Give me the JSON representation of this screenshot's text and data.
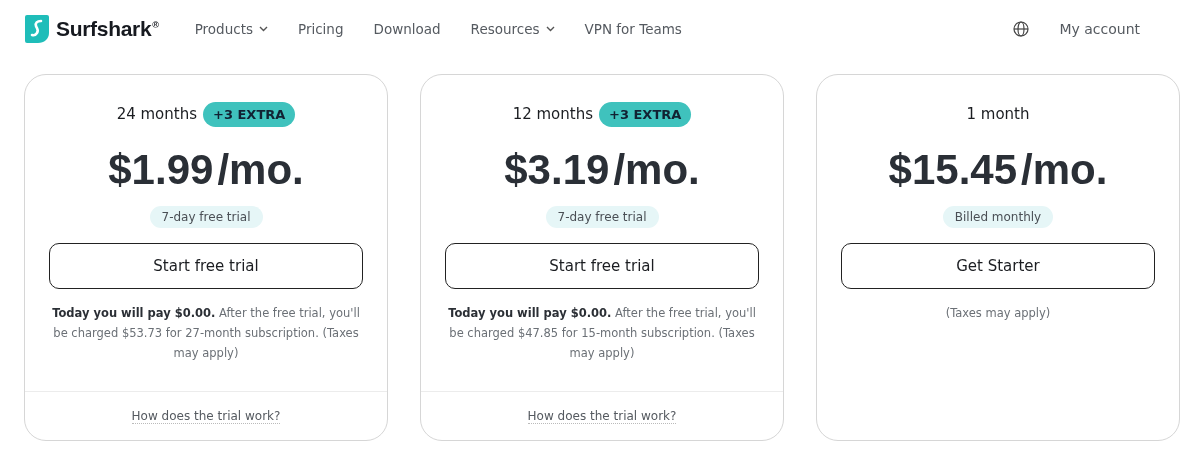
{
  "header": {
    "logo": "Surfshark",
    "logo_mark": "®",
    "nav": [
      {
        "label": "Products",
        "dropdown": true
      },
      {
        "label": "Pricing",
        "dropdown": false
      },
      {
        "label": "Download",
        "dropdown": false
      },
      {
        "label": "Resources",
        "dropdown": true
      },
      {
        "label": "VPN for Teams",
        "dropdown": false
      }
    ],
    "account": "My account"
  },
  "plans": [
    {
      "term": "24 months",
      "badge": "+3 EXTRA",
      "price": "$1.99",
      "unit": "/mo.",
      "pill": "7-day free trial",
      "button": "Start free trial",
      "note": "**Today you will pay $0.00.** After the free trial, you'll be charged $53.73 for 27-month subscription. (Taxes may apply)",
      "footer_link": "How does the trial work?"
    },
    {
      "term": "12 months",
      "badge": "+3 EXTRA",
      "price": "$3.19",
      "unit": "/mo.",
      "pill": "7-day free trial",
      "button": "Start free trial",
      "note": "**Today you will pay $0.00.** After the free trial, you'll be charged $47.85 for 15-month subscription. (Taxes may apply)",
      "footer_link": "How does the trial work?"
    },
    {
      "term": "1 month",
      "price": "$15.45",
      "unit": "/mo.",
      "pill": "Billed monthly",
      "button": "Get Starter",
      "note": "(Taxes may apply)"
    }
  ]
}
